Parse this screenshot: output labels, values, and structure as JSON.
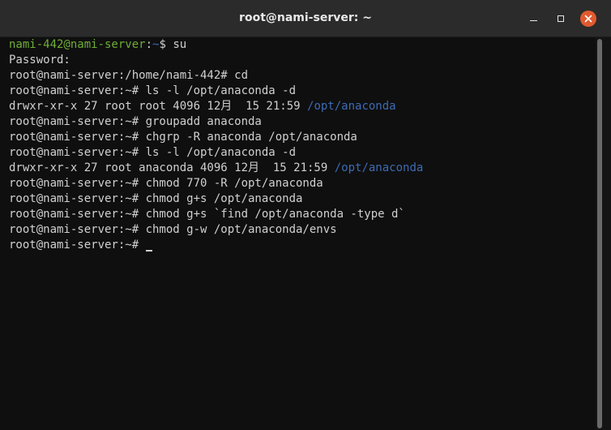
{
  "window": {
    "title": "root@nami-server: ~",
    "controls": {
      "minimize_icon": "minimize-icon",
      "maximize_icon": "maximize-icon",
      "close_icon": "close-icon"
    },
    "colors": {
      "titlebar": "#2b2b2b",
      "background": "#0f0f0f",
      "close": "#e05a30"
    }
  },
  "terminal": {
    "colors": {
      "text": "#d0d0d0",
      "prompt_user": "#6fae36",
      "directory": "#3d6bb3"
    },
    "lines": [
      {
        "prompt_user": "nami-442@nami-server",
        "prompt_sep": ":",
        "prompt_path": "~",
        "prompt_end": "$ ",
        "command": "su"
      },
      {
        "text": "Password:"
      },
      {
        "text": "root@nami-server:/home/nami-442# cd"
      },
      {
        "text": "root@nami-server:~# ls -l /opt/anaconda -d"
      },
      {
        "text": "drwxr-xr-x 27 root root 4096 12月  15 21:59 ",
        "dir": "/opt/anaconda"
      },
      {
        "text": "root@nami-server:~# groupadd anaconda"
      },
      {
        "text": "root@nami-server:~# chgrp -R anaconda /opt/anaconda"
      },
      {
        "text": "root@nami-server:~# ls -l /opt/anaconda -d"
      },
      {
        "text": "drwxr-xr-x 27 root anaconda 4096 12月  15 21:59 ",
        "dir": "/opt/anaconda"
      },
      {
        "text": "root@nami-server:~# chmod 770 -R /opt/anaconda"
      },
      {
        "text": "root@nami-server:~# chmod g+s /opt/anaconda"
      },
      {
        "text": "root@nami-server:~# chmod g+s `find /opt/anaconda -type d`"
      },
      {
        "text": "root@nami-server:~# chmod g-w /opt/anaconda/envs"
      },
      {
        "text": "root@nami-server:~# "
      }
    ]
  }
}
